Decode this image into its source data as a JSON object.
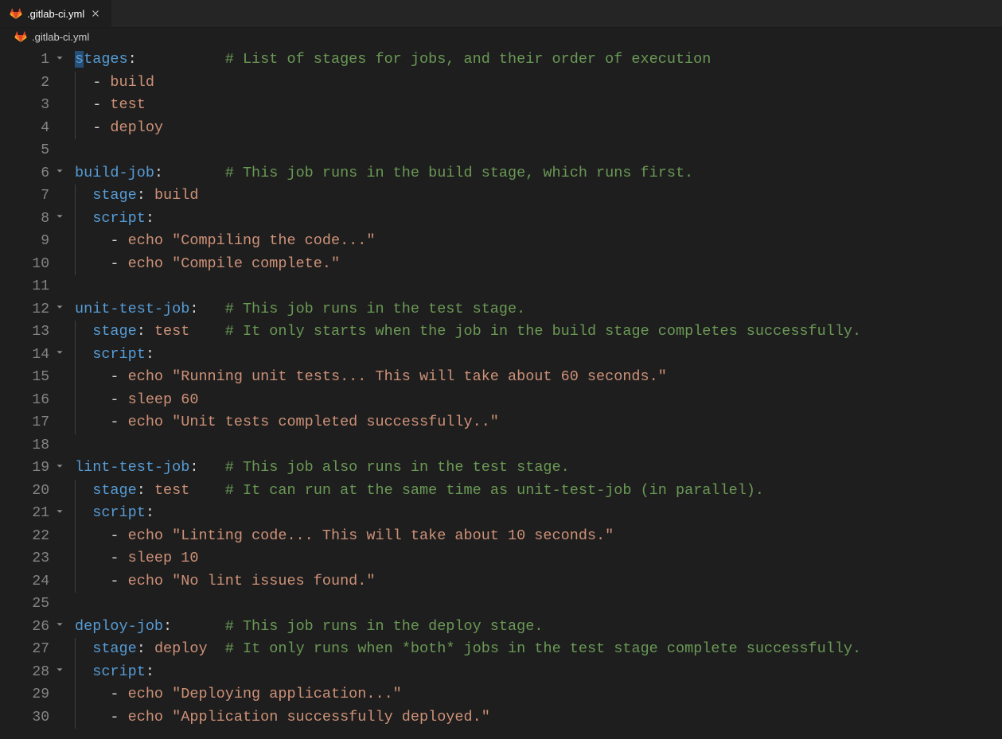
{
  "tab": {
    "label": ".gitlab-ci.yml"
  },
  "breadcrumb": {
    "label": ".gitlab-ci.yml"
  },
  "code": {
    "lines": [
      {
        "n": 1,
        "fold": true,
        "indent": 0,
        "segs": [
          {
            "c": "tk-key",
            "t": "stages",
            "sel": true
          },
          {
            "c": "tk-punc",
            "t": ":          "
          },
          {
            "c": "tk-cmt",
            "t": "# List of stages for jobs, and their order of execution"
          }
        ]
      },
      {
        "n": 2,
        "fold": false,
        "indent": 1,
        "segs": [
          {
            "c": "tk-dash",
            "t": "  - "
          },
          {
            "c": "tk-val",
            "t": "build"
          }
        ]
      },
      {
        "n": 3,
        "fold": false,
        "indent": 1,
        "segs": [
          {
            "c": "tk-dash",
            "t": "  - "
          },
          {
            "c": "tk-val",
            "t": "test"
          }
        ]
      },
      {
        "n": 4,
        "fold": false,
        "indent": 1,
        "segs": [
          {
            "c": "tk-dash",
            "t": "  - "
          },
          {
            "c": "tk-val",
            "t": "deploy"
          }
        ]
      },
      {
        "n": 5,
        "fold": false,
        "indent": 0,
        "segs": []
      },
      {
        "n": 6,
        "fold": true,
        "indent": 0,
        "segs": [
          {
            "c": "tk-key",
            "t": "build-job"
          },
          {
            "c": "tk-punc",
            "t": ":       "
          },
          {
            "c": "tk-cmt",
            "t": "# This job runs in the build stage, which runs first."
          }
        ]
      },
      {
        "n": 7,
        "fold": false,
        "indent": 1,
        "segs": [
          {
            "c": "tk-punc",
            "t": "  "
          },
          {
            "c": "tk-key",
            "t": "stage"
          },
          {
            "c": "tk-punc",
            "t": ": "
          },
          {
            "c": "tk-val",
            "t": "build"
          }
        ]
      },
      {
        "n": 8,
        "fold": true,
        "indent": 1,
        "segs": [
          {
            "c": "tk-punc",
            "t": "  "
          },
          {
            "c": "tk-key",
            "t": "script"
          },
          {
            "c": "tk-punc",
            "t": ":"
          }
        ]
      },
      {
        "n": 9,
        "fold": false,
        "indent": 2,
        "segs": [
          {
            "c": "tk-dash",
            "t": "    - "
          },
          {
            "c": "tk-val",
            "t": "echo \"Compiling the code...\""
          }
        ]
      },
      {
        "n": 10,
        "fold": false,
        "indent": 2,
        "segs": [
          {
            "c": "tk-dash",
            "t": "    - "
          },
          {
            "c": "tk-val",
            "t": "echo \"Compile complete.\""
          }
        ]
      },
      {
        "n": 11,
        "fold": false,
        "indent": 0,
        "segs": []
      },
      {
        "n": 12,
        "fold": true,
        "indent": 0,
        "segs": [
          {
            "c": "tk-key",
            "t": "unit-test-job"
          },
          {
            "c": "tk-punc",
            "t": ":   "
          },
          {
            "c": "tk-cmt",
            "t": "# This job runs in the test stage."
          }
        ]
      },
      {
        "n": 13,
        "fold": false,
        "indent": 1,
        "segs": [
          {
            "c": "tk-punc",
            "t": "  "
          },
          {
            "c": "tk-key",
            "t": "stage"
          },
          {
            "c": "tk-punc",
            "t": ": "
          },
          {
            "c": "tk-val",
            "t": "test"
          },
          {
            "c": "tk-punc",
            "t": "    "
          },
          {
            "c": "tk-cmt",
            "t": "# It only starts when the job in the build stage completes successfully."
          }
        ]
      },
      {
        "n": 14,
        "fold": true,
        "indent": 1,
        "segs": [
          {
            "c": "tk-punc",
            "t": "  "
          },
          {
            "c": "tk-key",
            "t": "script"
          },
          {
            "c": "tk-punc",
            "t": ":"
          }
        ]
      },
      {
        "n": 15,
        "fold": false,
        "indent": 2,
        "segs": [
          {
            "c": "tk-dash",
            "t": "    - "
          },
          {
            "c": "tk-val",
            "t": "echo \"Running unit tests... This will take about 60 seconds.\""
          }
        ]
      },
      {
        "n": 16,
        "fold": false,
        "indent": 2,
        "segs": [
          {
            "c": "tk-dash",
            "t": "    - "
          },
          {
            "c": "tk-val",
            "t": "sleep 60"
          }
        ]
      },
      {
        "n": 17,
        "fold": false,
        "indent": 2,
        "segs": [
          {
            "c": "tk-dash",
            "t": "    - "
          },
          {
            "c": "tk-val",
            "t": "echo \"Unit tests completed successfully..\""
          }
        ]
      },
      {
        "n": 18,
        "fold": false,
        "indent": 0,
        "segs": []
      },
      {
        "n": 19,
        "fold": true,
        "indent": 0,
        "segs": [
          {
            "c": "tk-key",
            "t": "lint-test-job"
          },
          {
            "c": "tk-punc",
            "t": ":   "
          },
          {
            "c": "tk-cmt",
            "t": "# This job also runs in the test stage."
          }
        ]
      },
      {
        "n": 20,
        "fold": false,
        "indent": 1,
        "segs": [
          {
            "c": "tk-punc",
            "t": "  "
          },
          {
            "c": "tk-key",
            "t": "stage"
          },
          {
            "c": "tk-punc",
            "t": ": "
          },
          {
            "c": "tk-val",
            "t": "test"
          },
          {
            "c": "tk-punc",
            "t": "    "
          },
          {
            "c": "tk-cmt",
            "t": "# It can run at the same time as unit-test-job (in parallel)."
          }
        ]
      },
      {
        "n": 21,
        "fold": true,
        "indent": 1,
        "segs": [
          {
            "c": "tk-punc",
            "t": "  "
          },
          {
            "c": "tk-key",
            "t": "script"
          },
          {
            "c": "tk-punc",
            "t": ":"
          }
        ]
      },
      {
        "n": 22,
        "fold": false,
        "indent": 2,
        "segs": [
          {
            "c": "tk-dash",
            "t": "    - "
          },
          {
            "c": "tk-val",
            "t": "echo \"Linting code... This will take about 10 seconds.\""
          }
        ]
      },
      {
        "n": 23,
        "fold": false,
        "indent": 2,
        "segs": [
          {
            "c": "tk-dash",
            "t": "    - "
          },
          {
            "c": "tk-val",
            "t": "sleep 10"
          }
        ]
      },
      {
        "n": 24,
        "fold": false,
        "indent": 2,
        "segs": [
          {
            "c": "tk-dash",
            "t": "    - "
          },
          {
            "c": "tk-val",
            "t": "echo \"No lint issues found.\""
          }
        ]
      },
      {
        "n": 25,
        "fold": false,
        "indent": 0,
        "segs": []
      },
      {
        "n": 26,
        "fold": true,
        "indent": 0,
        "segs": [
          {
            "c": "tk-key",
            "t": "deploy-job"
          },
          {
            "c": "tk-punc",
            "t": ":      "
          },
          {
            "c": "tk-cmt",
            "t": "# This job runs in the deploy stage."
          }
        ]
      },
      {
        "n": 27,
        "fold": false,
        "indent": 1,
        "segs": [
          {
            "c": "tk-punc",
            "t": "  "
          },
          {
            "c": "tk-key",
            "t": "stage"
          },
          {
            "c": "tk-punc",
            "t": ": "
          },
          {
            "c": "tk-val",
            "t": "deploy"
          },
          {
            "c": "tk-punc",
            "t": "  "
          },
          {
            "c": "tk-cmt",
            "t": "# It only runs when *both* jobs in the test stage complete successfully."
          }
        ]
      },
      {
        "n": 28,
        "fold": true,
        "indent": 1,
        "segs": [
          {
            "c": "tk-punc",
            "t": "  "
          },
          {
            "c": "tk-key",
            "t": "script"
          },
          {
            "c": "tk-punc",
            "t": ":"
          }
        ]
      },
      {
        "n": 29,
        "fold": false,
        "indent": 2,
        "segs": [
          {
            "c": "tk-dash",
            "t": "    - "
          },
          {
            "c": "tk-val",
            "t": "echo \"Deploying application...\""
          }
        ]
      },
      {
        "n": 30,
        "fold": false,
        "indent": 2,
        "segs": [
          {
            "c": "tk-dash",
            "t": "    - "
          },
          {
            "c": "tk-val",
            "t": "echo \"Application successfully deployed.\""
          }
        ]
      }
    ]
  }
}
